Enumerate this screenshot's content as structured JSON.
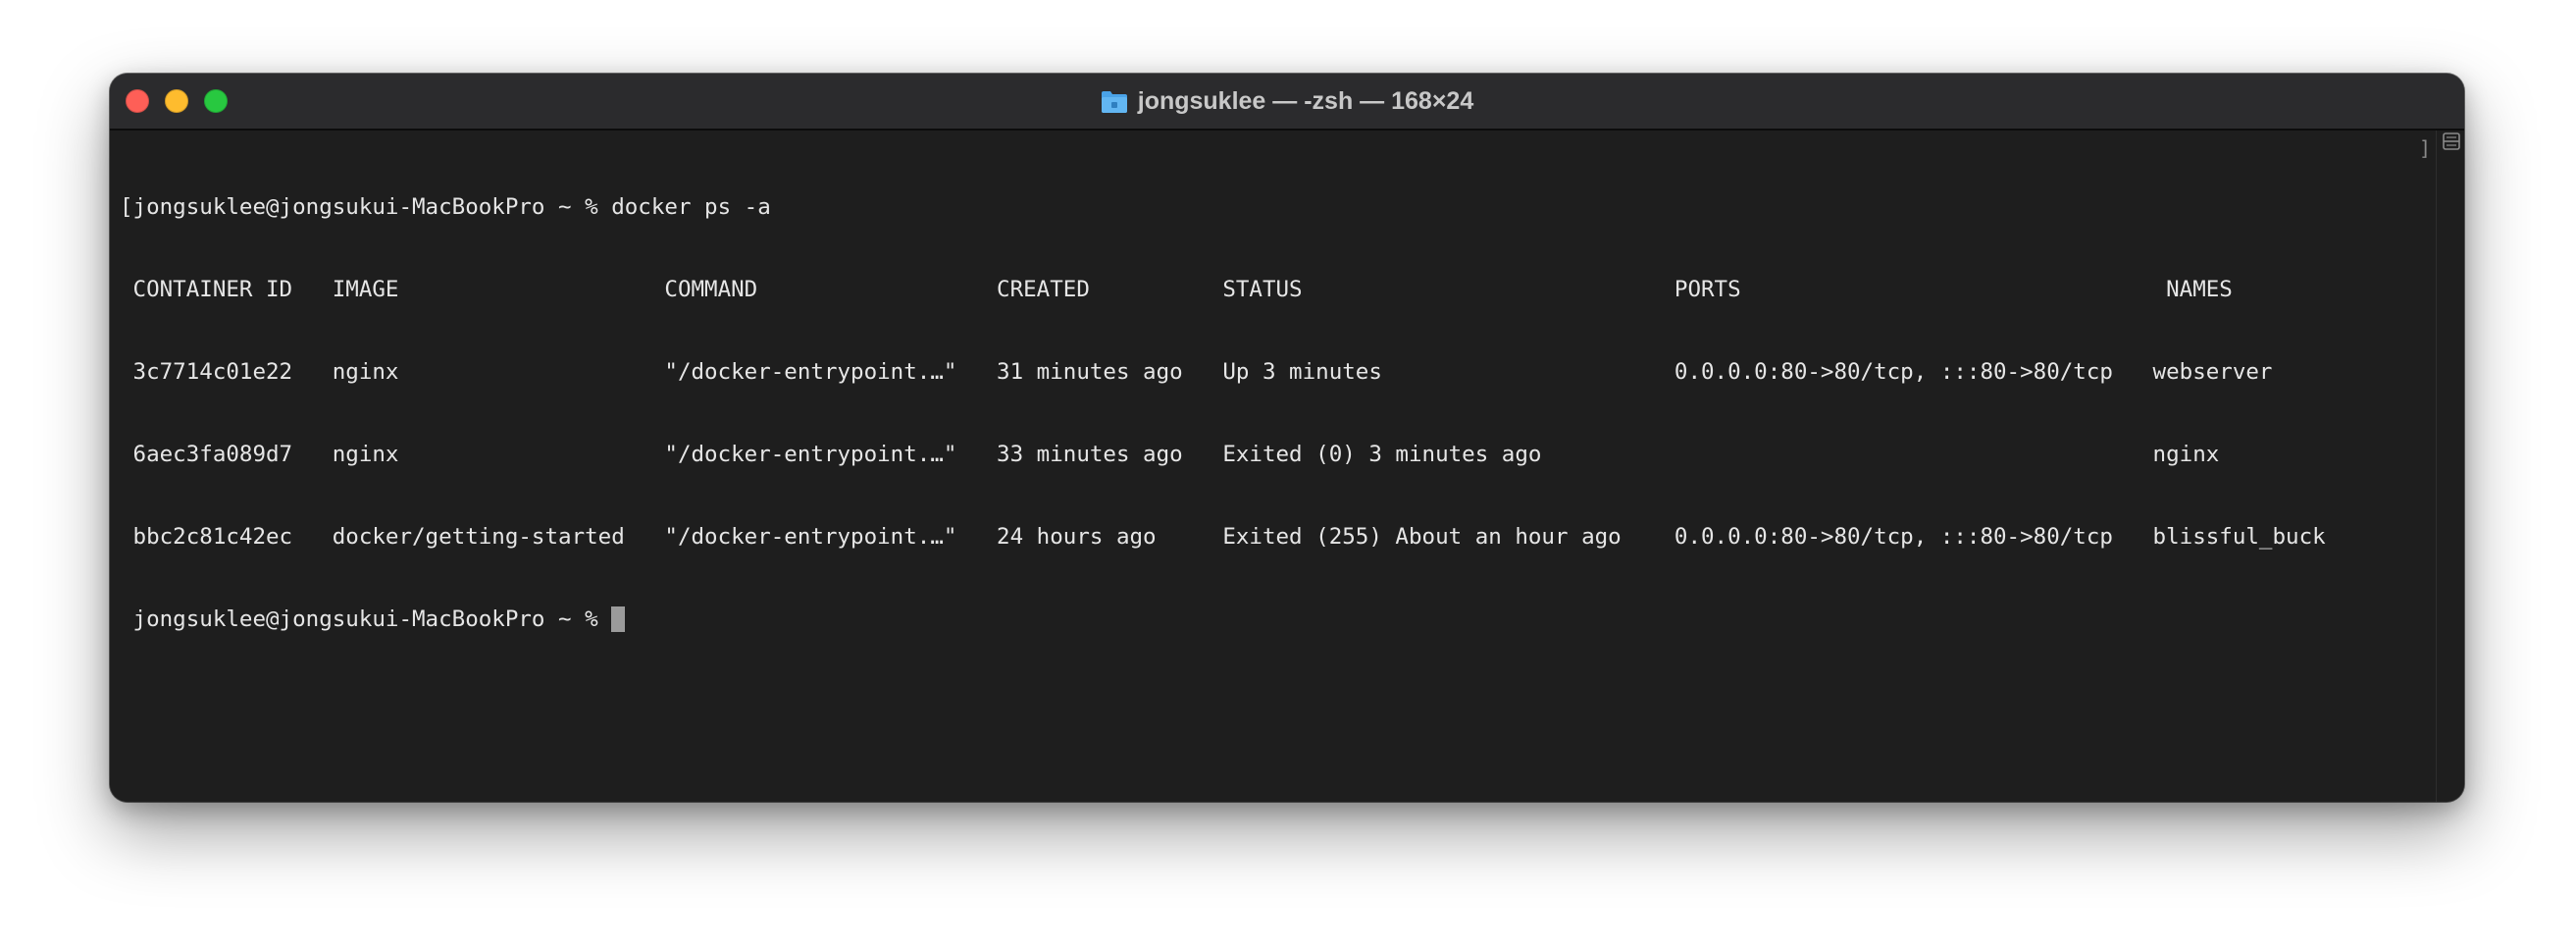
{
  "window": {
    "title": "jongsuklee — -zsh — 168×24"
  },
  "terminal": {
    "lines": [
      "[jongsuklee@jongsukui-MacBookPro ~ % docker ps -a",
      " CONTAINER ID   IMAGE                    COMMAND                  CREATED          STATUS                            PORTS                                NAMES",
      " 3c7714c01e22   nginx                    \"/docker-entrypoint.…\"   31 minutes ago   Up 3 minutes                      0.0.0.0:80->80/tcp, :::80->80/tcp   webserver",
      " 6aec3fa089d7   nginx                    \"/docker-entrypoint.…\"   33 minutes ago   Exited (0) 3 minutes ago                                              nginx",
      " bbc2c81c42ec   docker/getting-started   \"/docker-entrypoint.…\"   24 hours ago     Exited (255) About an hour ago    0.0.0.0:80->80/tcp, :::80->80/tcp   blissful_buck"
    ],
    "prompt": " jongsuklee@jongsukui-MacBookPro ~ % ",
    "mark_bracket": "]"
  },
  "icons": {
    "folder": "folder-icon",
    "split": "split-pane-icon"
  }
}
